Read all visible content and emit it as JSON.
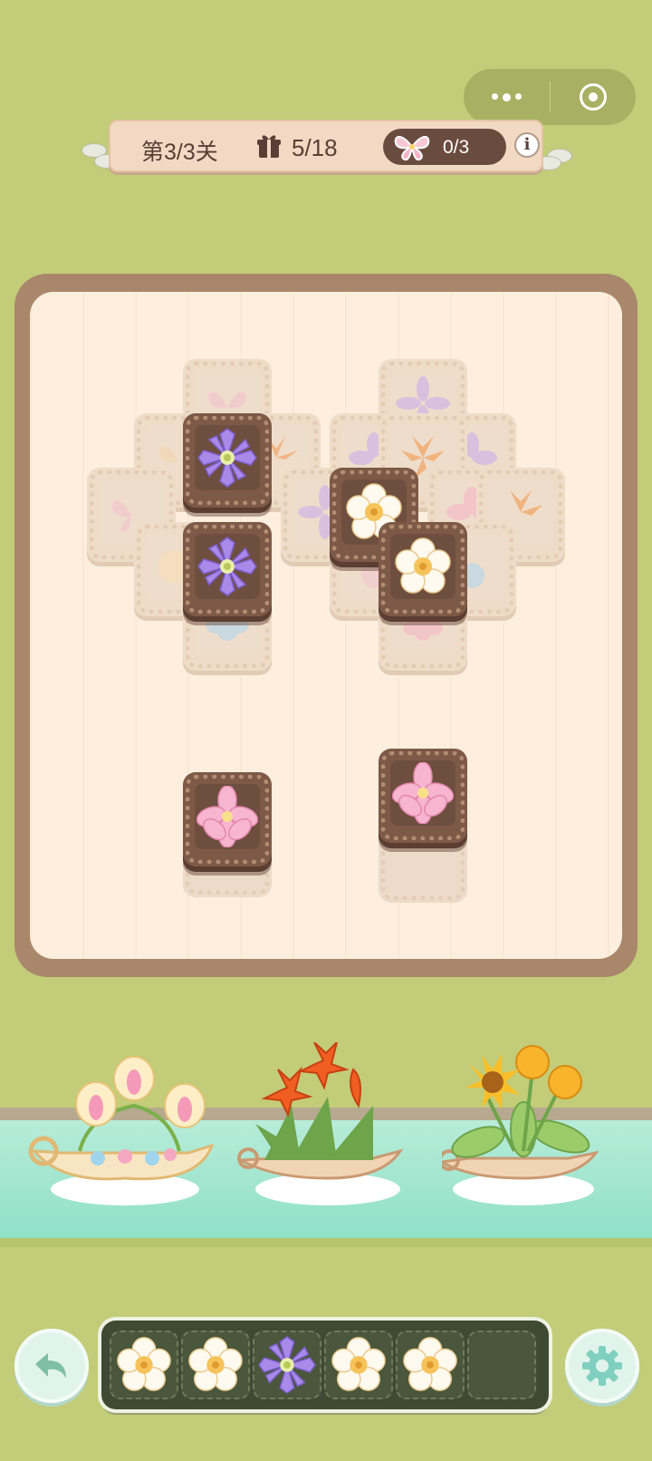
{
  "header": {
    "level_text": "第3/3关",
    "gift_count": "5/18",
    "butterfly_count": "0/3",
    "info_label": "i"
  },
  "capsule": {
    "menu_icon": "more-dots-icon",
    "close_icon": "target-icon"
  },
  "board": {
    "top_tiles": [
      {
        "flower": "purple-clematis"
      },
      {
        "flower": "purple-clematis"
      },
      {
        "flower": "white-plumeria"
      },
      {
        "flower": "white-plumeria"
      },
      {
        "flower": "pink-lily"
      },
      {
        "flower": "pink-lily"
      }
    ],
    "faded_tiles": [
      "pink-butterfly",
      "butterfly",
      "purple",
      "orange-lily",
      "white",
      "blue",
      "purple",
      "orange-lily",
      "pink",
      "orange-lily",
      "pink",
      "blue",
      "pink"
    ]
  },
  "pots": [
    {
      "name": "tulip-boat"
    },
    {
      "name": "orange-lily-pot"
    },
    {
      "name": "sunflower-pot"
    }
  ],
  "tray": {
    "slots": [
      "white-plumeria",
      "white-plumeria",
      "purple-clematis",
      "white-plumeria",
      "white-plumeria",
      ""
    ]
  },
  "colors": {
    "background": "#c3cc78",
    "board": "#fdeedd",
    "tile": "#7d5a47",
    "tray": "#3f4a33",
    "river": "#9fe3cc"
  }
}
